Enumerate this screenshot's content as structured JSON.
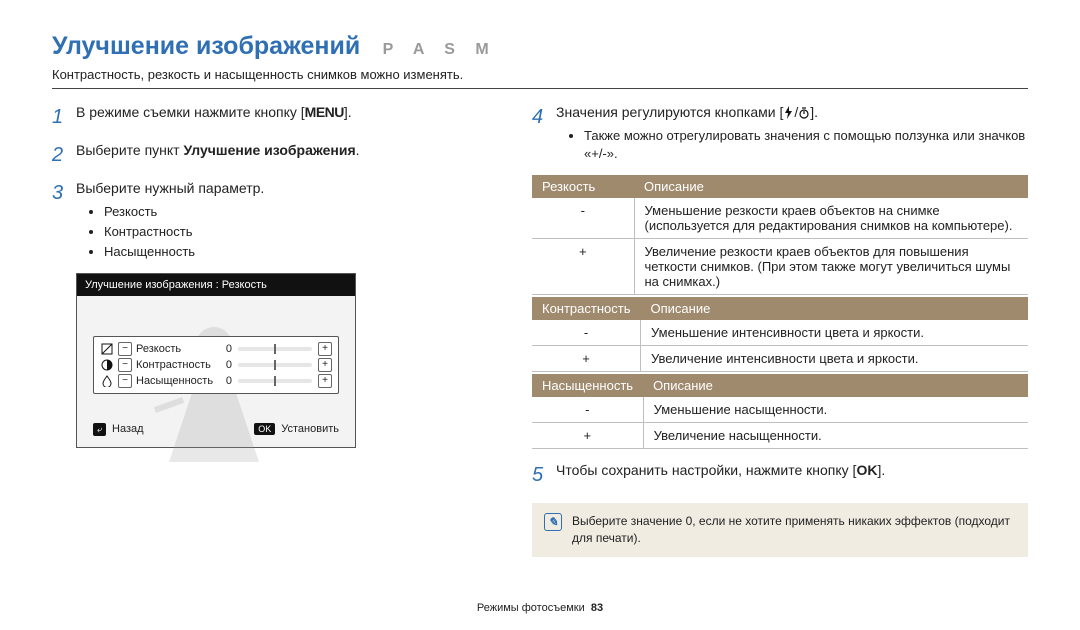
{
  "title": "Улучшение изображений",
  "modes": "P A S M",
  "subtitle": "Контрастность, резкость и насыщенность снимков можно изменять.",
  "steps_left": {
    "s1": {
      "num": "1",
      "text_a": "В режиме съемки нажмите кнопку [",
      "menu": "MENU",
      "text_b": "]."
    },
    "s2": {
      "num": "2",
      "text_a": "Выберите пункт ",
      "bold": "Улучшение изображения",
      "text_b": "."
    },
    "s3": {
      "num": "3",
      "text_a": "Выберите нужный параметр.",
      "items": [
        "Резкость",
        "Контрастность",
        "Насыщенность"
      ]
    }
  },
  "lcd": {
    "header": "Улучшение изображения : Резкость",
    "rows": [
      {
        "icon": "sharp",
        "label": "Резкость",
        "value": "0"
      },
      {
        "icon": "contrast",
        "label": "Контрастность",
        "value": "0"
      },
      {
        "icon": "saturation",
        "label": "Насыщенность",
        "value": "0"
      }
    ],
    "footer": {
      "back_key": "⤶",
      "back_label": "Назад",
      "ok_key": "OK",
      "ok_label": "Установить"
    }
  },
  "steps_right": {
    "s4": {
      "num": "4",
      "text_a": "Значения регулируются кнопками [",
      "text_b": "].",
      "bullet": "Также можно отрегулировать значения с помощью ползунка или значков «+/-»."
    },
    "s5": {
      "num": "5",
      "text_a": "Чтобы сохранить настройки, нажмите кнопку [",
      "ok": "OK",
      "text_b": "]."
    }
  },
  "tables": {
    "sharp": {
      "head1": "Резкость",
      "head2": "Описание",
      "rows": [
        [
          "-",
          "Уменьшение резкости краев объектов на снимке (используется для редактирования снимков на компьютере)."
        ],
        [
          "+",
          "Увеличение резкости краев объектов для повышения четкости снимков. (При этом также могут увеличиться шумы на снимках.)"
        ]
      ]
    },
    "contrast": {
      "head1": "Контрастность",
      "head2": "Описание",
      "rows": [
        [
          "-",
          "Уменьшение интенсивности цвета и яркости."
        ],
        [
          "+",
          "Увеличение интенсивности цвета и яркости."
        ]
      ]
    },
    "sat": {
      "head1": "Насыщенность",
      "head2": "Описание",
      "rows": [
        [
          "-",
          "Уменьшение насыщенности."
        ],
        [
          "+",
          "Увеличение насыщенности."
        ]
      ]
    }
  },
  "note": "Выберите значение 0, если не хотите применять никаких эффектов (подходит для печати).",
  "footer": {
    "section": "Режимы фотосъемки",
    "page": "83"
  }
}
